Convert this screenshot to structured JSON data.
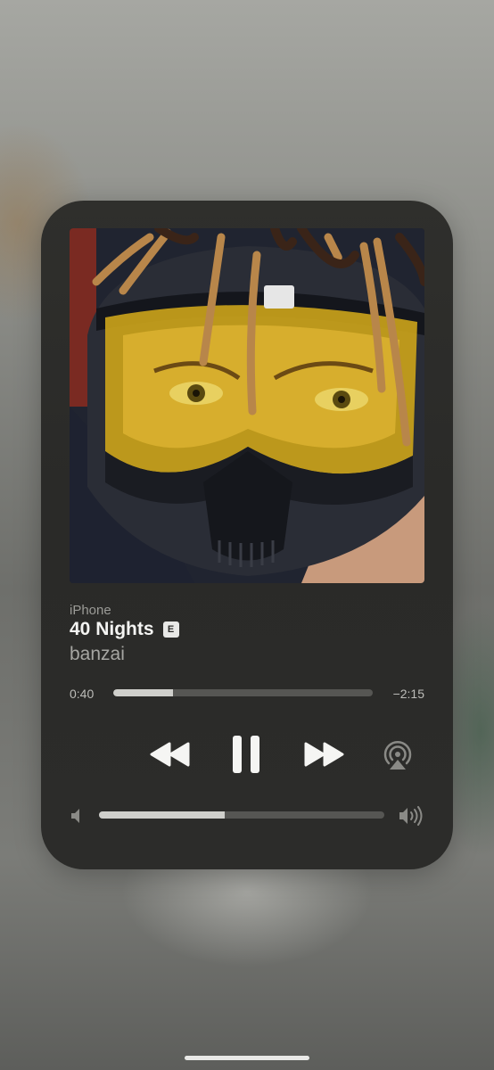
{
  "now_playing": {
    "source": "iPhone",
    "title": "40 Nights",
    "explicit_badge": "E",
    "artist": "banzai",
    "elapsed": "0:40",
    "remaining": "−2:15",
    "progress_fraction": 0.23,
    "volume_fraction": 0.44
  },
  "icons": {
    "rewind": "rewind-icon",
    "pause": "pause-icon",
    "forward": "fast-forward-icon",
    "airplay": "airplay-icon",
    "volume_low": "speaker-low-icon",
    "volume_high": "speaker-high-icon"
  },
  "colors": {
    "card_background": "#2c2c2a",
    "track_filled": "#cfcfcb",
    "track_empty": "#565653",
    "art_goggle_tint": "#c9a21a"
  }
}
